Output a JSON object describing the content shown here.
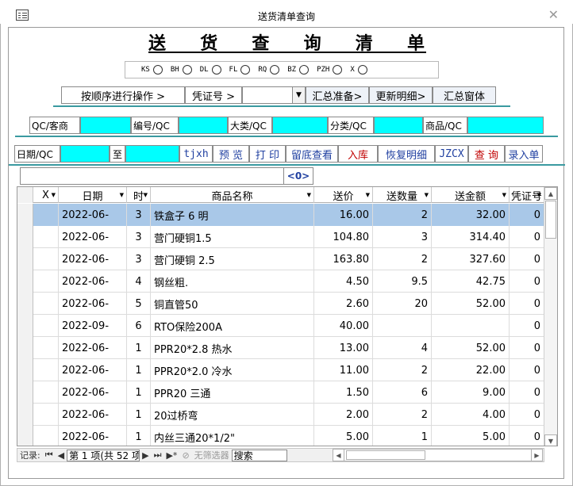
{
  "window": {
    "title": "送货清单查询",
    "close_glyph": "✕"
  },
  "header": {
    "title_chars": [
      "送",
      "货",
      "查",
      "询",
      "清",
      "单"
    ]
  },
  "radio_options": [
    "KS",
    "BH",
    "DL",
    "FL",
    "RQ",
    "BZ",
    "PZH",
    "X"
  ],
  "ops": {
    "sequence_button": "按顺序进行操作 >",
    "voucher_label": "凭证号 >",
    "voucher_value": "",
    "summary_prep": "汇总准备>",
    "update_detail": "更新明细>",
    "summary_window": "汇总窗体"
  },
  "filters": {
    "customer_label": "QC/客商",
    "code_label": "编号/QC",
    "category_label": "大类/QC",
    "subcategory_label": "分类/QC",
    "product_label": "商品/QC"
  },
  "date_row": {
    "date_label": "日期/QC",
    "to_label": "至",
    "tjxh": "tjxh",
    "preview": "预 览",
    "print": "打 印",
    "keep_view": "留底查看",
    "stock_in": "入库",
    "restore_detail": "恢复明细",
    "jzcx": "JZCX",
    "query": "查 询",
    "entry": "录入单"
  },
  "record_count": "<0>",
  "grid": {
    "columns": [
      "X",
      "日期",
      "时",
      "商品名称",
      "送价",
      "送数量",
      "送金额",
      "凭证号"
    ],
    "rows": [
      {
        "x": "",
        "date": "2022-06-",
        "t": "3",
        "name": "铁盒子 6 明",
        "price": "16.00",
        "qty": "2",
        "amount": "32.00",
        "voucher": "0"
      },
      {
        "x": "",
        "date": "2022-06-",
        "t": "3",
        "name": "营门硬铜1.5",
        "price": "104.80",
        "qty": "3",
        "amount": "314.40",
        "voucher": "0"
      },
      {
        "x": "",
        "date": "2022-06-",
        "t": "3",
        "name": "营门硬铜 2.5",
        "price": "163.80",
        "qty": "2",
        "amount": "327.60",
        "voucher": "0"
      },
      {
        "x": "",
        "date": "2022-06-",
        "t": "4",
        "name": "钢丝粗.",
        "price": "4.50",
        "qty": "9.5",
        "amount": "42.75",
        "voucher": "0"
      },
      {
        "x": "",
        "date": "2022-06-",
        "t": "5",
        "name": "铜直管50",
        "price": "2.60",
        "qty": "20",
        "amount": "52.00",
        "voucher": "0"
      },
      {
        "x": "",
        "date": "2022-09-",
        "t": "6",
        "name": "RTO保险200A",
        "price": "40.00",
        "qty": "",
        "amount": "",
        "voucher": "0"
      },
      {
        "x": "",
        "date": "2022-06-",
        "t": "1",
        "name": "PPR20*2.8 热水",
        "price": "13.00",
        "qty": "4",
        "amount": "52.00",
        "voucher": "0"
      },
      {
        "x": "",
        "date": "2022-06-",
        "t": "1",
        "name": "PPR20*2.0 冷水",
        "price": "11.00",
        "qty": "2",
        "amount": "22.00",
        "voucher": "0"
      },
      {
        "x": "",
        "date": "2022-06-",
        "t": "1",
        "name": "PPR20 三通",
        "price": "1.50",
        "qty": "6",
        "amount": "9.00",
        "voucher": "0"
      },
      {
        "x": "",
        "date": "2022-06-",
        "t": "1",
        "name": "20过桥弯",
        "price": "2.00",
        "qty": "2",
        "amount": "4.00",
        "voucher": "0"
      },
      {
        "x": "",
        "date": "2022-06-",
        "t": "1",
        "name": "内丝三通20*1/2\"",
        "price": "5.00",
        "qty": "1",
        "amount": "5.00",
        "voucher": "0"
      }
    ]
  },
  "nav": {
    "record_label": "记录:",
    "first": "⏮",
    "prev": "◀",
    "position": "第 1 项(共 52 项",
    "next": "▶",
    "last": "⏭",
    "new": "▶*",
    "no_filter": "无筛选器",
    "search_placeholder": "搜索"
  }
}
